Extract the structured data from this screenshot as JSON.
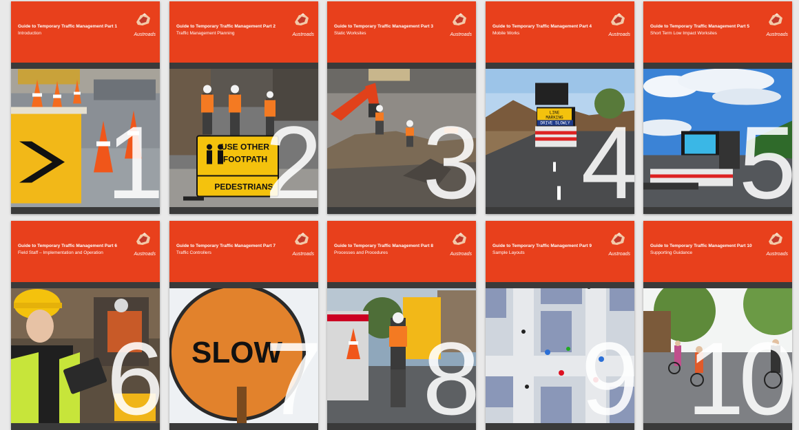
{
  "brand": "Austroads",
  "accent_color": "#e8401c",
  "books": [
    {
      "title": "Guide to Temporary Traffic Management Part 1",
      "subtitle": "Introduction",
      "number": "1",
      "scene": "cones-chevron"
    },
    {
      "title": "Guide to Temporary Traffic Management Part 2",
      "subtitle": "Traffic Management Planning",
      "number": "2",
      "scene": "pedestrian-sign"
    },
    {
      "title": "Guide to Temporary Traffic Management Part 3",
      "subtitle": "Static Worksites",
      "number": "3",
      "scene": "excavator"
    },
    {
      "title": "Guide to Temporary Traffic Management Part 4",
      "subtitle": "Mobile Works",
      "number": "4",
      "scene": "arrow-truck"
    },
    {
      "title": "Guide to Temporary Traffic Management Part 5",
      "subtitle": "Short Term Low Impact Worksites",
      "number": "5",
      "scene": "sky-truck"
    },
    {
      "title": "Guide to Temporary Traffic Management Part 6",
      "subtitle": "Field Staff – Implementation and Operation",
      "number": "6",
      "scene": "worker-tablet"
    },
    {
      "title": "Guide to Temporary Traffic Management Part 7",
      "subtitle": "Traffic Controllers",
      "number": "7",
      "scene": "slow-sign"
    },
    {
      "title": "Guide to Temporary Traffic Management Part 8",
      "subtitle": "Processes and Procedures",
      "number": "8",
      "scene": "controller-street"
    },
    {
      "title": "Guide to Temporary Traffic Management Part 9",
      "subtitle": "Sample Layouts",
      "number": "9",
      "scene": "layout-plan"
    },
    {
      "title": "Guide to Temporary Traffic Management Part 10",
      "subtitle": "Supporting Guidance",
      "number": "10",
      "scene": "cyclists-park"
    }
  ],
  "scene_text": {
    "pedestrian_sign_line1": "USE OTHER",
    "pedestrian_sign_line2": "FOOTPATH",
    "pedestrian_sign_line3": "PEDESTRIANS",
    "vms_line1": "LINE",
    "vms_line2": "MARKING",
    "vms_line3": "DRIVE SLOWLY",
    "slow_sign": "SLOW"
  }
}
